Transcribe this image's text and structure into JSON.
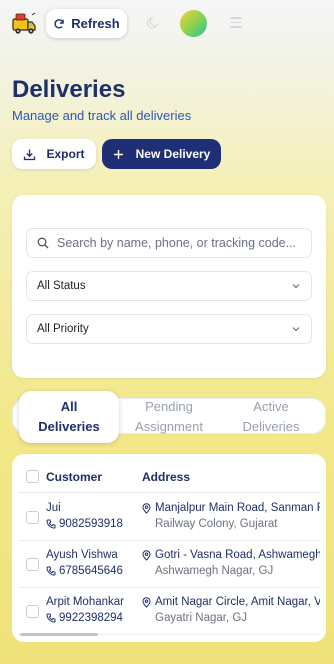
{
  "topbar": {
    "refresh_label": "Refresh"
  },
  "header": {
    "title": "Deliveries",
    "subtitle": "Manage and track all deliveries",
    "export_label": "Export",
    "new_delivery_label": "New Delivery"
  },
  "filters": {
    "search_placeholder": "Search by name, phone, or tracking code...",
    "status_value": "All Status",
    "priority_value": "All Priority"
  },
  "tabs": [
    {
      "label_line1": "All",
      "label_line2": "Deliveries",
      "active": true
    },
    {
      "label_line1": "Pending",
      "label_line2": "Assignment",
      "active": false
    },
    {
      "label_line1": "Active",
      "label_line2": "Deliveries",
      "active": false
    }
  ],
  "table": {
    "headers": {
      "customer": "Customer",
      "address": "Address"
    },
    "rows": [
      {
        "name": "Jui",
        "phone": "9082593918",
        "address_line1": "Manjalpur Main Road, Sanman Re",
        "address_line2": "Railway Colony, Gujarat"
      },
      {
        "name": "Ayush Vishwa",
        "phone": "6785645646",
        "address_line1": "Gotri - Vasna Road, Ashwamegh",
        "address_line2": "Ashwamegh Nagar, GJ"
      },
      {
        "name": "Arpit Mohankar",
        "phone": "9922398294",
        "address_line1": "Amit Nagar Circle, Amit Nagar, V",
        "address_line2": "Gayatri Nagar, GJ"
      }
    ]
  },
  "colors": {
    "brand_navy": "#1f2f75",
    "subtitle_blue": "#2f55b0",
    "background_yellow": "#f2e88a"
  }
}
